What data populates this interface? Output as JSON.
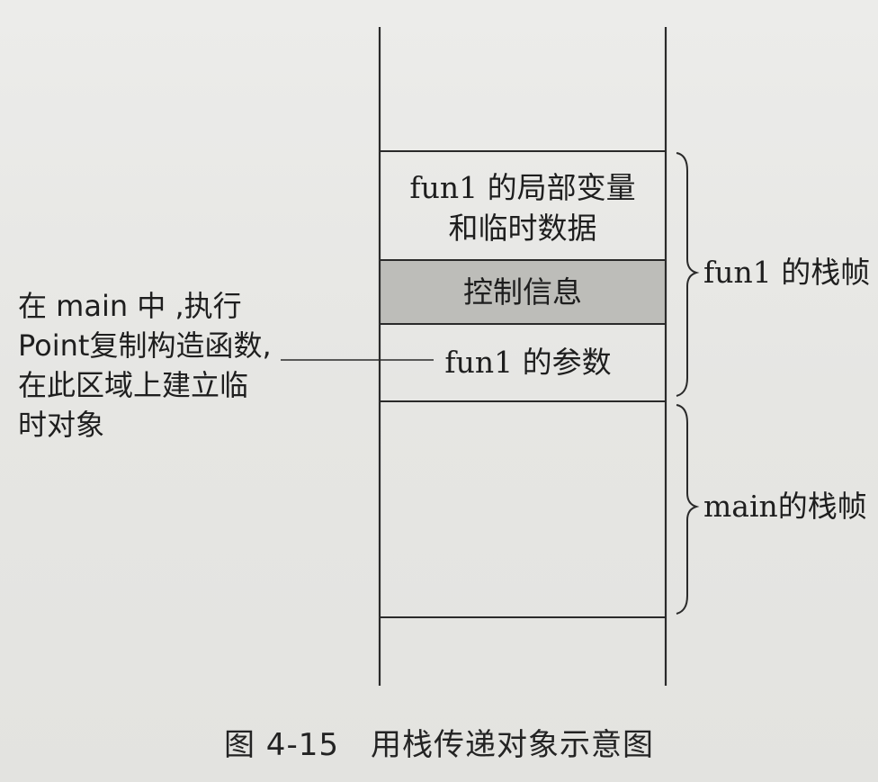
{
  "stack": {
    "local_vars_line1": "fun1 的局部变量",
    "local_vars_line2": "和临时数据",
    "control_info": "控制信息",
    "params": "fun1 的参数"
  },
  "braces": {
    "fun1_frame": "fun1 的栈帧",
    "main_frame": "main的栈帧"
  },
  "annotation": {
    "line1": "在 main 中 ,执行",
    "line2": "Point复制构造函数,",
    "line3": "在此区域上建立临",
    "line4": "时对象"
  },
  "caption": "图 4-15　用栈传递对象示意图",
  "colors": {
    "control_fill": "#bdbdb9",
    "line": "#2a2a2a"
  }
}
